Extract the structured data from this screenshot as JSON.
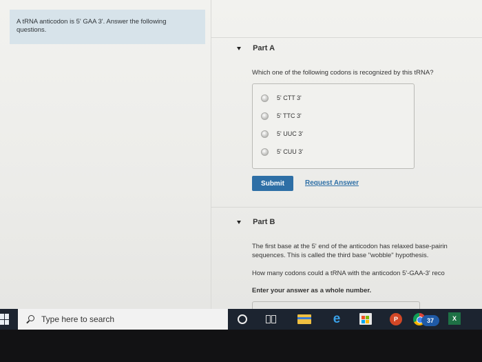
{
  "intro": {
    "text_line1": "A tRNA anticodon is 5' GAA 3'. Answer the following",
    "text_line2": "questions."
  },
  "part_a": {
    "title": "Part A",
    "question": "Which one of the following codons is recognized by this tRNA?",
    "options": [
      "5' CTT 3'",
      "5' TTC 3'",
      "5' UUC 3'",
      "5' CUU 3'"
    ],
    "submit_label": "Submit",
    "request_answer_label": "Request Answer"
  },
  "part_b": {
    "title": "Part B",
    "paragraph_line1": "The first base at the 5' end of the anticodon has relaxed base-pairin",
    "paragraph_line2": "sequences. This is called the third base \"wobble\" hypothesis.",
    "question": "How many codons could a tRNA with the anticodon 5'-GAA-3' reco",
    "instruction": "Enter your answer as a whole number."
  },
  "taskbar": {
    "search_placeholder": "Type here to search",
    "outlook_badge": "37",
    "powerpoint_letter": "P",
    "excel_letter": "X"
  },
  "colors": {
    "accent": "#2e6fa6",
    "intro_bg": "#d7e3ea",
    "taskbar_bg": "#1c2430"
  }
}
